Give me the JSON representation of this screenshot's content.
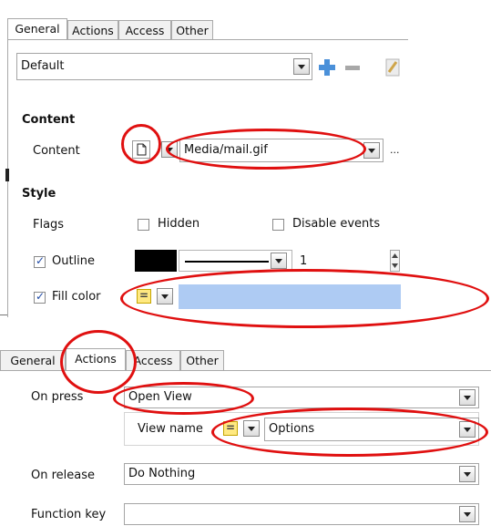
{
  "top_panel": {
    "tabs": [
      "General",
      "Actions",
      "Access",
      "Other"
    ],
    "style_select": "Default",
    "content_section_title": "Content",
    "content_label": "Content",
    "content_path": "Media/mail.gif",
    "ellipsis": "...",
    "style_section_title": "Style",
    "flags_label": "Flags",
    "hidden_label": "Hidden",
    "disable_events_label": "Disable events",
    "outline_label": "Outline",
    "outline_width": "1",
    "fill_color_label": "Fill color",
    "fill_color": "#aecbf3",
    "outline_color": "#000000",
    "eq_symbol": "="
  },
  "bottom_panel": {
    "tabs": [
      "General",
      "Actions",
      "Access",
      "Other"
    ],
    "on_press_label": "On press",
    "on_press_value": "Open View",
    "view_name_label": "View name",
    "view_name_value": "Options",
    "on_release_label": "On release",
    "on_release_value": "Do Nothing",
    "function_key_label": "Function key",
    "function_key_value": "",
    "eq_symbol": "="
  },
  "annotation_color": "#e01010"
}
